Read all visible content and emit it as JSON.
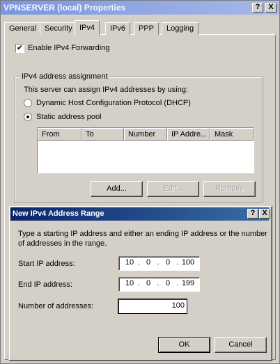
{
  "window": {
    "title": "VPNSERVER (local) Properties",
    "help_glyph": "?",
    "close_glyph": "X"
  },
  "tabs": [
    {
      "label": "General"
    },
    {
      "label": "Security"
    },
    {
      "label": "IPv4",
      "active": true
    },
    {
      "label": "IPv6"
    },
    {
      "label": "PPP"
    },
    {
      "label": "Logging"
    }
  ],
  "ipv4": {
    "forwarding_label": "Enable IPv4 Forwarding",
    "forwarding_checked": true,
    "check_glyph": "✔",
    "group_label": "IPv4 address assignment",
    "group_desc": "This server can assign IPv4 addresses by using:",
    "dhcp_label": "Dynamic Host Configuration Protocol (DHCP)",
    "static_label": "Static address pool",
    "selected": "static",
    "columns": [
      "From",
      "To",
      "Number",
      "IP Addre...",
      "Mask"
    ],
    "add_label": "Add...",
    "edit_label": "Edit...",
    "remove_label": "Remove"
  },
  "dialog": {
    "title": "New IPv4 Address Range",
    "help_glyph": "?",
    "close_glyph": "X",
    "description": "Type a starting IP address and either an ending IP address or the number of addresses in the range.",
    "start_label": "Start IP address:",
    "start_ip": [
      "10",
      "0",
      "0",
      "100"
    ],
    "end_label": "End IP address:",
    "end_ip": [
      "10",
      "0",
      "0",
      "199"
    ],
    "count_label": "Number of addresses:",
    "count_value": "100",
    "ok_label": "OK",
    "cancel_label": "Cancel"
  }
}
